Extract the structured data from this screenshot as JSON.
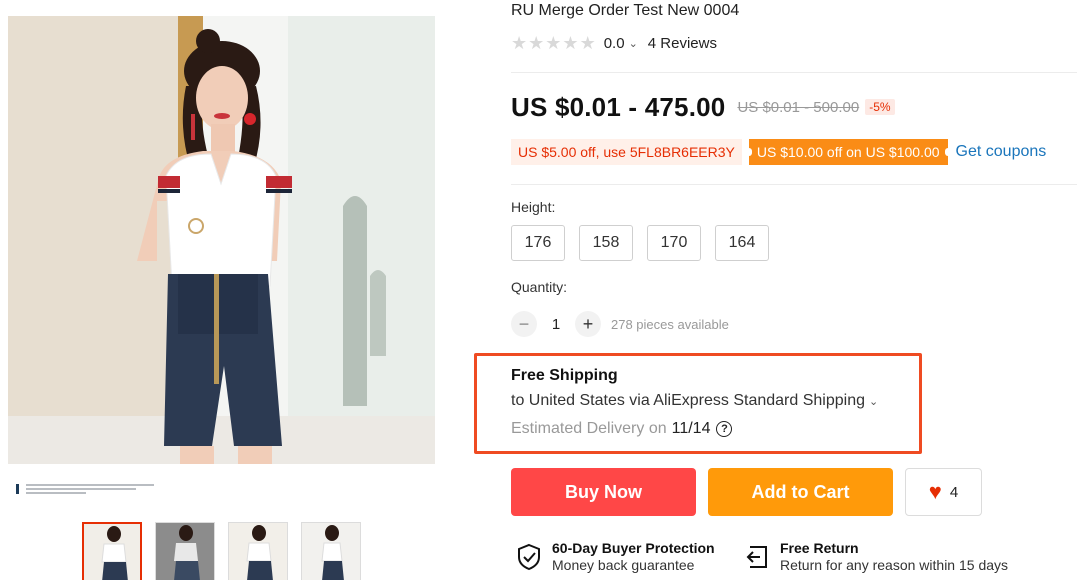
{
  "product": {
    "title": "RU Merge Order Test New 0004",
    "rating": "0.0",
    "reviews": "4 Reviews",
    "price": "US $0.01 - 475.00",
    "old_price": "US $0.01 - 500.00",
    "discount": "-5%"
  },
  "coupons": {
    "coupon1": "US $5.00 off, use 5FL8BR6EER3Y",
    "coupon2": "US $10.00 off on US $100.00",
    "get_coupons": "Get coupons"
  },
  "height": {
    "label": "Height:",
    "options": [
      "176",
      "158",
      "170",
      "164"
    ]
  },
  "quantity": {
    "label": "Quantity:",
    "minus": "−",
    "value": "1",
    "plus": "+",
    "available": "278 pieces available"
  },
  "shipping": {
    "title": "Free Shipping",
    "destination": "to United States via AliExpress Standard Shipping",
    "estimated_label": "Estimated Delivery on",
    "estimated_date": "11/14",
    "help": "?"
  },
  "actions": {
    "buy_now": "Buy Now",
    "add_to_cart": "Add to Cart",
    "wishlist_count": "4"
  },
  "guarantees": [
    {
      "title": "60-Day Buyer Protection",
      "subtitle": "Money back guarantee",
      "icon": "shield-check-icon"
    },
    {
      "title": "Free Return",
      "subtitle": "Return for any reason within 15 days",
      "icon": "return-box-icon"
    }
  ],
  "colors": {
    "accent": "#e62e04",
    "buy": "#ff4747",
    "cart": "#ff9a0a",
    "link": "#1a75bb",
    "highlight_box": "#ef4b22"
  }
}
